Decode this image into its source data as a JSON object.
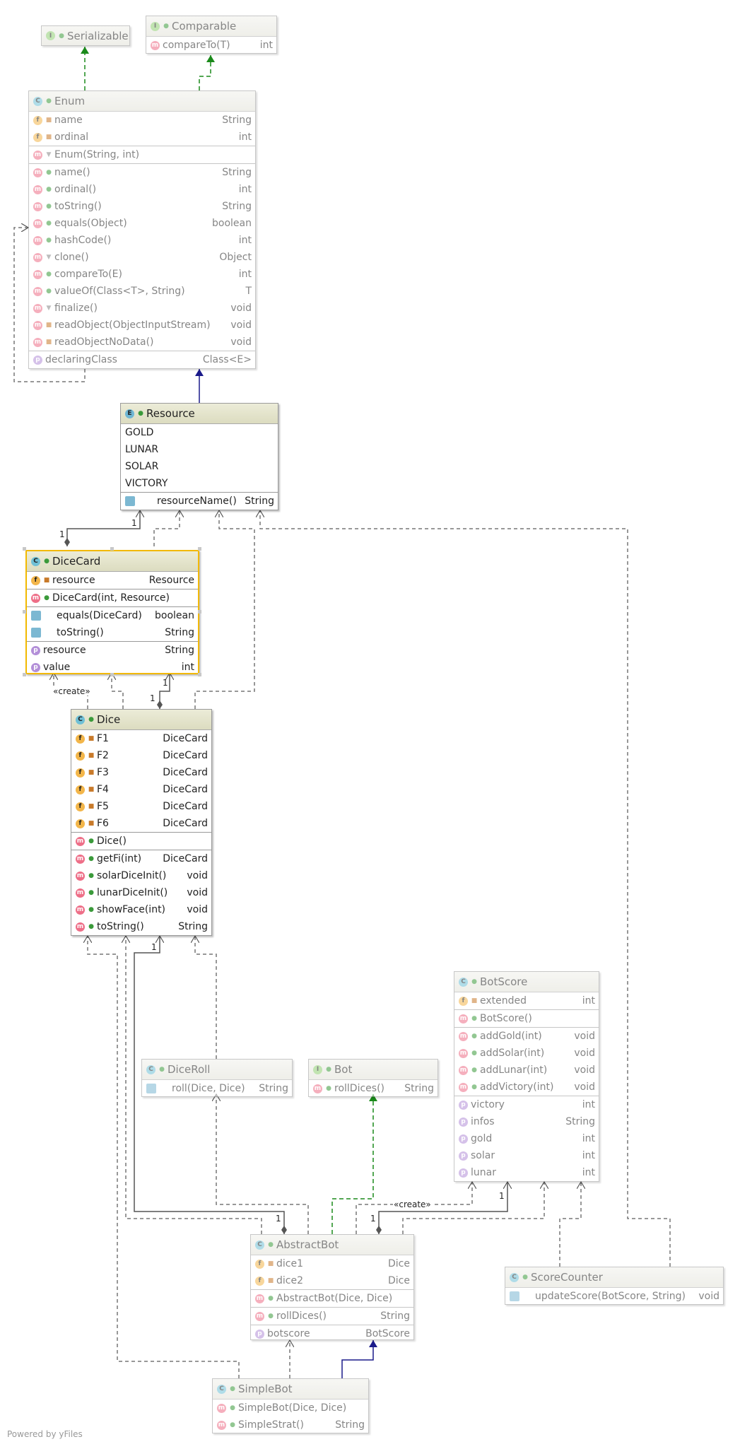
{
  "classes": {
    "serializable": {
      "name": "Serializable"
    },
    "comparable": {
      "name": "Comparable",
      "methods": [
        {
          "name": "compareTo(T)",
          "type": "int"
        }
      ]
    },
    "enum": {
      "name": "Enum",
      "fields": [
        {
          "name": "name",
          "type": "String"
        },
        {
          "name": "ordinal",
          "type": "int"
        }
      ],
      "constructors": [
        {
          "name": "Enum(String, int)",
          "type": ""
        }
      ],
      "methods": [
        {
          "name": "name()",
          "type": "String"
        },
        {
          "name": "ordinal()",
          "type": "int"
        },
        {
          "name": "toString()",
          "type": "String"
        },
        {
          "name": "equals(Object)",
          "type": "boolean"
        },
        {
          "name": "hashCode()",
          "type": "int"
        },
        {
          "name": "clone()",
          "type": "Object"
        },
        {
          "name": "compareTo(E)",
          "type": "int"
        },
        {
          "name": "valueOf(Class<T>, String)",
          "type": "T"
        },
        {
          "name": "finalize()",
          "type": "void"
        },
        {
          "name": "readObject(ObjectInputStream)",
          "type": "void"
        },
        {
          "name": "readObjectNoData()",
          "type": "void"
        }
      ],
      "properties": [
        {
          "name": "declaringClass",
          "type": "Class<E>"
        }
      ]
    },
    "resource": {
      "name": "Resource",
      "constants": [
        "GOLD",
        "LUNAR",
        "SOLAR",
        "VICTORY"
      ],
      "methods": [
        {
          "name": "resourceName()",
          "type": "String"
        }
      ]
    },
    "dicecard": {
      "name": "DiceCard",
      "fields": [
        {
          "name": "resource",
          "type": "Resource"
        }
      ],
      "constructors": [
        {
          "name": "DiceCard(int, Resource)",
          "type": ""
        }
      ],
      "methods": [
        {
          "name": "equals(DiceCard)",
          "type": "boolean"
        },
        {
          "name": "toString()",
          "type": "String"
        }
      ],
      "properties": [
        {
          "name": "resource",
          "type": "String"
        },
        {
          "name": "value",
          "type": "int"
        }
      ]
    },
    "dice": {
      "name": "Dice",
      "fields": [
        {
          "name": "F1",
          "type": "DiceCard"
        },
        {
          "name": "F2",
          "type": "DiceCard"
        },
        {
          "name": "F3",
          "type": "DiceCard"
        },
        {
          "name": "F4",
          "type": "DiceCard"
        },
        {
          "name": "F5",
          "type": "DiceCard"
        },
        {
          "name": "F6",
          "type": "DiceCard"
        }
      ],
      "constructors": [
        {
          "name": "Dice()",
          "type": ""
        }
      ],
      "methods": [
        {
          "name": "getFi(int)",
          "type": "DiceCard"
        },
        {
          "name": "solarDiceInit()",
          "type": "void"
        },
        {
          "name": "lunarDiceInit()",
          "type": "void"
        },
        {
          "name": "showFace(int)",
          "type": "void"
        },
        {
          "name": "toString()",
          "type": "String"
        }
      ]
    },
    "botscore": {
      "name": "BotScore",
      "fields": [
        {
          "name": "extended",
          "type": "int"
        }
      ],
      "constructors": [
        {
          "name": "BotScore()",
          "type": ""
        }
      ],
      "methods": [
        {
          "name": "addGold(int)",
          "type": "void"
        },
        {
          "name": "addSolar(int)",
          "type": "void"
        },
        {
          "name": "addLunar(int)",
          "type": "void"
        },
        {
          "name": "addVictory(int)",
          "type": "void"
        }
      ],
      "properties": [
        {
          "name": "victory",
          "type": "int"
        },
        {
          "name": "infos",
          "type": "String"
        },
        {
          "name": "gold",
          "type": "int"
        },
        {
          "name": "solar",
          "type": "int"
        },
        {
          "name": "lunar",
          "type": "int"
        }
      ]
    },
    "diceroll": {
      "name": "DiceRoll",
      "methods": [
        {
          "name": "roll(Dice, Dice)",
          "type": "String"
        }
      ]
    },
    "bot": {
      "name": "Bot",
      "methods": [
        {
          "name": "rollDices()",
          "type": "String"
        }
      ]
    },
    "abstractbot": {
      "name": "AbstractBot",
      "fields": [
        {
          "name": "dice1",
          "type": "Dice"
        },
        {
          "name": "dice2",
          "type": "Dice"
        }
      ],
      "constructors": [
        {
          "name": "AbstractBot(Dice, Dice)",
          "type": ""
        }
      ],
      "methods": [
        {
          "name": "rollDices()",
          "type": "String"
        }
      ],
      "properties": [
        {
          "name": "botscore",
          "type": "BotScore"
        }
      ]
    },
    "scorecounter": {
      "name": "ScoreCounter",
      "methods": [
        {
          "name": "updateScore(BotScore, String)",
          "type": "void"
        }
      ]
    },
    "simplebot": {
      "name": "SimpleBot",
      "constructors": [
        {
          "name": "SimpleBot(Dice, Dice)",
          "type": ""
        }
      ],
      "methods": [
        {
          "name": "SimpleStrat()",
          "type": "String"
        }
      ]
    }
  },
  "edge_labels": {
    "create1": "«create»",
    "create2": "«create»",
    "one": "1"
  },
  "footer": "Powered by yFiles",
  "colors": {
    "realization": "#1a8a1a",
    "generalization": "#1a1a8a",
    "dependency": "#777777"
  }
}
